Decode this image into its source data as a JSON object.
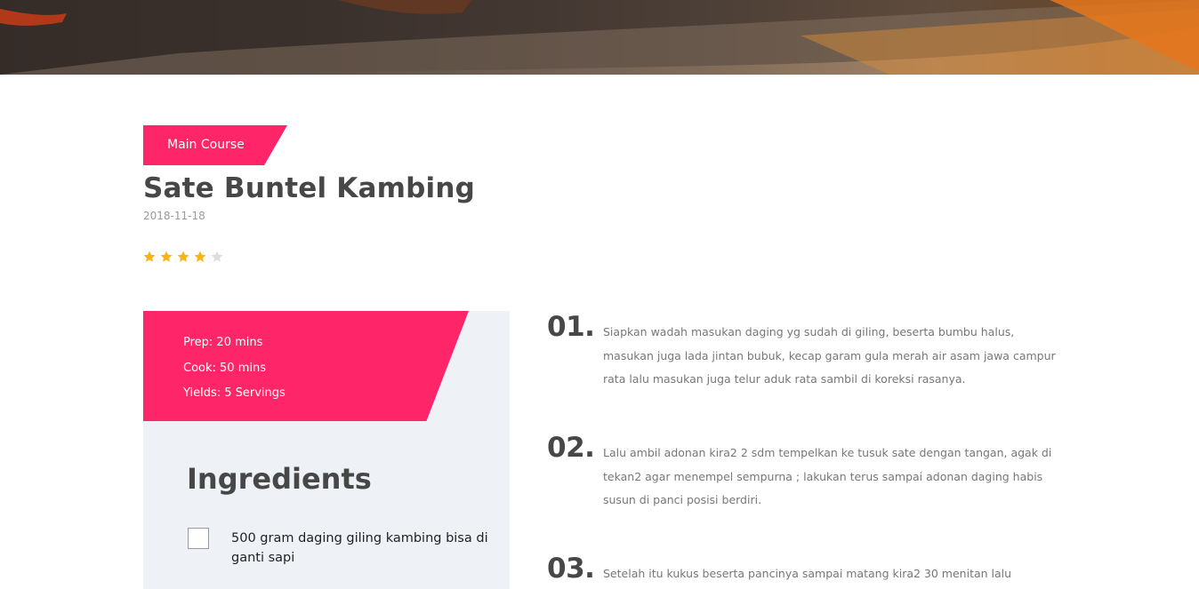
{
  "hero": {
    "alt": "sate photo"
  },
  "recipe": {
    "category": "Main Course",
    "title": "Sate Buntel Kambing",
    "date": "2018-11-18",
    "rating": 4,
    "rating_max": 5,
    "star_color": "#f8b314",
    "star_empty_color": "#dddddd",
    "accent_color": "#fe2568"
  },
  "times": {
    "prep": "Prep: 20 mins",
    "cook": "Cook: 50 mins",
    "yields": "Yields: 5 Servings"
  },
  "ingredients": {
    "heading": "Ingredients",
    "items": [
      {
        "text": "500 gram daging giling kambing bisa di ganti sapi",
        "checked": false
      }
    ]
  },
  "directions": [
    {
      "number": "01.",
      "text": "Siapkan wadah masukan daging yg sudah di giling, beserta bumbu halus, masukan juga lada jintan bubuk, kecap garam gula merah air asam jawa campur rata lalu masukan juga telur aduk rata sambil di koreksi rasanya."
    },
    {
      "number": "02.",
      "text": "Lalu ambil adonan kira2 2 sdm tempelkan ke tusuk sate dengan tangan, agak di tekan2 agar menempel sempurna ; lakukan terus sampai adonan daging habis susun di panci posisi berdiri."
    },
    {
      "number": "03.",
      "text": "Setelah itu kukus beserta pancinya sampai matang kira2 30 menitan lalu"
    }
  ]
}
